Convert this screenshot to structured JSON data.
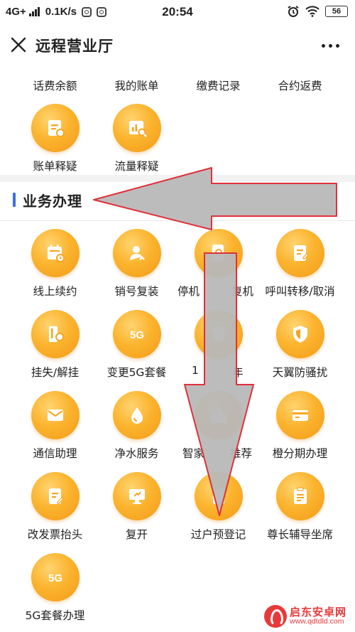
{
  "status_bar": {
    "network": "4G+",
    "speed": "0.1K/s",
    "time": "20:54",
    "battery": "56",
    "icons": [
      "signal-icon",
      "app-notification-icon",
      "alarm-icon",
      "wifi-icon",
      "battery-icon"
    ]
  },
  "nav": {
    "title": "远程营业厅",
    "close_icon": "close-icon",
    "more_icon": "more-icon"
  },
  "top_partial_row": [
    {
      "label": "话费余额"
    },
    {
      "label": "我的账单"
    },
    {
      "label": "缴费记录"
    },
    {
      "label": "合约返费"
    }
  ],
  "inquiry_row": [
    {
      "label": "账单释疑",
      "icon": "bill-doc-icon"
    },
    {
      "label": "流量释疑",
      "icon": "data-chart-icon"
    }
  ],
  "section": {
    "title": "业务办理",
    "accent_color": "#3b6fe8"
  },
  "services": [
    {
      "label": "线上续约",
      "icon": "calendar-clock-icon"
    },
    {
      "label": "销号复装",
      "icon": "user-reply-icon"
    },
    {
      "label": "停机",
      "label2": "复机",
      "icon": "phone-search-icon"
    },
    {
      "label": "呼叫转移/取消",
      "icon": "forward-doc-icon"
    },
    {
      "label": "挂失/解挂",
      "icon": "card-lock-icon"
    },
    {
      "label": "变更5G套餐",
      "icon": "5g-icon"
    },
    {
      "label": "1",
      "label2": "年",
      "icon": "unknown-icon"
    },
    {
      "label": "天翼防骚扰",
      "icon": "shield-icon"
    },
    {
      "label": "通信助理",
      "icon": "mail-icon"
    },
    {
      "label": "净水服务",
      "icon": "water-drop-icon"
    },
    {
      "label": "智家",
      "label2": "推荐",
      "icon": "home-icon"
    },
    {
      "label": "橙分期办理",
      "icon": "credit-card-icon"
    },
    {
      "label": "改发票抬头",
      "icon": "invoice-edit-icon"
    },
    {
      "label": "复开",
      "icon": "monitor-restart-icon"
    },
    {
      "label": "过户预登记",
      "icon": "transfer-doc-icon"
    },
    {
      "label": "尊长辅导坐席",
      "icon": "clipboard-icon"
    },
    {
      "label": "5G套餐办理",
      "icon": "5g-icon"
    }
  ],
  "colors": {
    "icon_orange": "#f9a825",
    "arrow_fill": "#b8b8b8",
    "arrow_stroke": "#e0303a"
  },
  "watermark": {
    "brand": "启东安卓网",
    "url": "www.qdtdld.com"
  }
}
